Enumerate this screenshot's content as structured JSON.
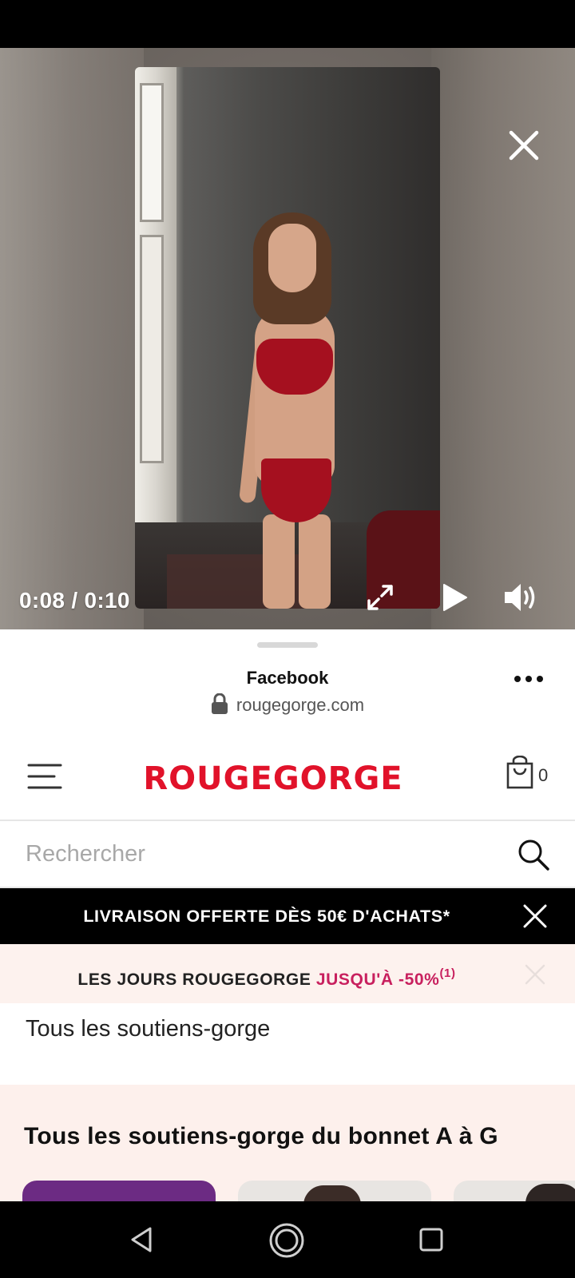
{
  "video": {
    "current_time": "0:08",
    "duration": "0:10",
    "time_separator": "/",
    "progress_fraction": 0.76
  },
  "sheet": {
    "title": "Facebook",
    "url": "rougegorge.com"
  },
  "site": {
    "brand": "ROUGEGORGE",
    "cart_count": "0",
    "search_placeholder": "Rechercher"
  },
  "promo": {
    "text": "LIVRAISON OFFERTE DÈS 50€ D'ACHATS*"
  },
  "days_banner": {
    "prefix": "LES JOURS ROUGEGORGE ",
    "highlight": "JUSQU'À -50%",
    "note": "(1)"
  },
  "category_link": "Tous les soutiens-gorge",
  "section_title": "Tous les soutiens-gorge du bonnet A à G",
  "colors": {
    "brand_red": "#e1122a",
    "highlight_pink": "#c8205e",
    "promo_bg": "#000000",
    "days_bg": "#fdf2ee",
    "card_purple": "#6c2b83"
  },
  "icons": {
    "close": "close-icon",
    "fullscreen": "expand-icon",
    "play": "play-icon",
    "volume": "volume-icon",
    "lock": "lock-icon",
    "more": "more-icon",
    "menu": "hamburger-icon",
    "cart": "shopping-bag-icon",
    "search": "search-icon",
    "nav_back": "back-triangle-icon",
    "nav_home": "home-circle-icon",
    "nav_recents": "recents-square-icon"
  }
}
